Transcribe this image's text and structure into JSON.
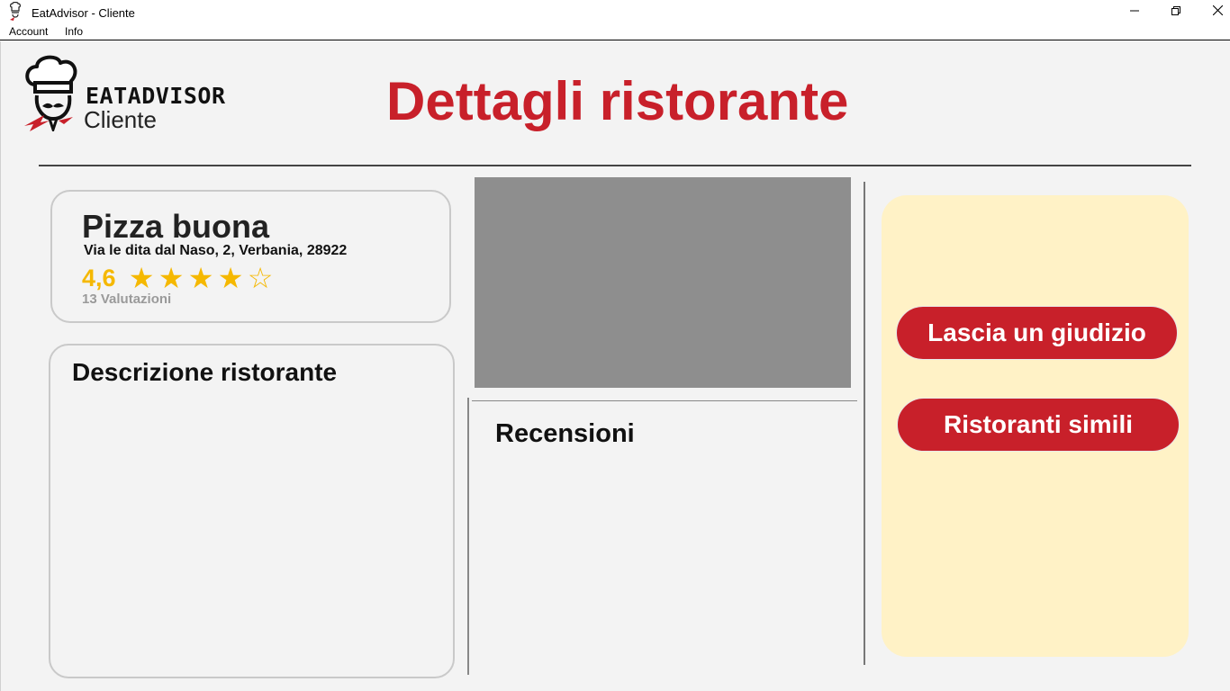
{
  "window": {
    "title": "EatAdvisor  - Cliente"
  },
  "menubar": {
    "items": [
      "Account",
      "Info"
    ]
  },
  "logo": {
    "brand": "EATADVISOR",
    "subtitle": "Cliente"
  },
  "page": {
    "title": "Dettagli ristorante"
  },
  "restaurant": {
    "name": "Pizza buona",
    "address": "Via le dita dal Naso, 2, Verbania, 28922",
    "rating_text": "4,6",
    "rating_stars": {
      "filled": 4,
      "total": 5
    },
    "reviews_count": "13 Valutazioni"
  },
  "description": {
    "title": "Descrizione ristorante"
  },
  "reviews": {
    "title": "Recensioni"
  },
  "actions": {
    "review_button": "Lascia un giudizio",
    "similar_button": "Ristoranti simili"
  },
  "colors": {
    "accent": "#c8202a",
    "star": "#f5b800",
    "panel": "#fff2c6",
    "background": "#f3f3f3"
  }
}
